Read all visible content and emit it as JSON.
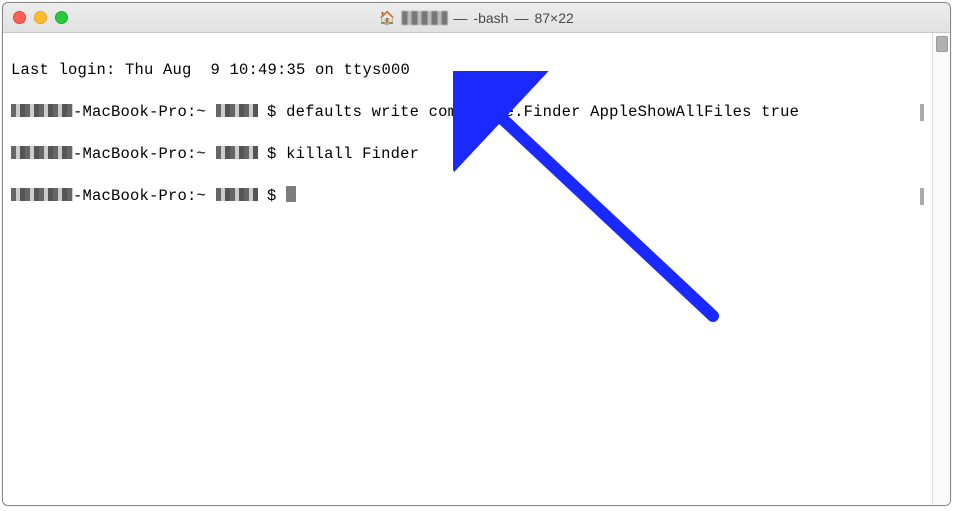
{
  "window": {
    "title_sep1": " — ",
    "shell": "-bash",
    "title_sep2": " — ",
    "dimensions": "87×22"
  },
  "terminal": {
    "last_login": "Last login: Thu Aug  9 10:49:35 on ttys000",
    "host_suffix": "-MacBook-Pro:~ ",
    "prompt_char": "$ ",
    "cmd1": "defaults write com.apple.Finder AppleShowAllFiles true",
    "cmd2": "killall Finder",
    "cmd3": ""
  },
  "colors": {
    "arrow": "#1a29ff"
  }
}
